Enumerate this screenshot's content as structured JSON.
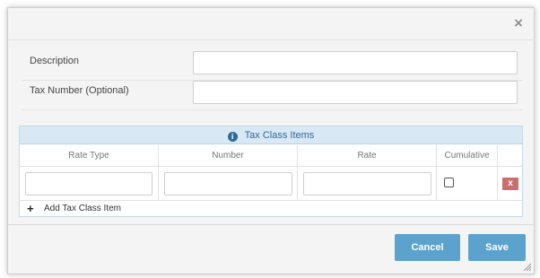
{
  "modal": {
    "close_glyph": "×"
  },
  "form": {
    "description": {
      "label": "Description",
      "value": ""
    },
    "tax_number": {
      "label": "Tax Number (Optional)",
      "value": ""
    }
  },
  "tax_class_items": {
    "title": "Tax Class Items",
    "info_glyph": "i",
    "columns": [
      "Rate Type",
      "Number",
      "Rate",
      "Cumulative"
    ],
    "rows": [
      {
        "rate_type": "",
        "number": "",
        "rate": "",
        "cumulative": false,
        "delete_label": "x"
      }
    ],
    "add_label": "Add Tax Class Item",
    "add_glyph": "+"
  },
  "footer": {
    "cancel_label": "Cancel",
    "save_label": "Save"
  },
  "colors": {
    "primary_button": "#5ba2cd",
    "delete_button": "#c86f6f",
    "panel_header": "#d9e8f5",
    "panel_title": "#2b6a9c"
  }
}
